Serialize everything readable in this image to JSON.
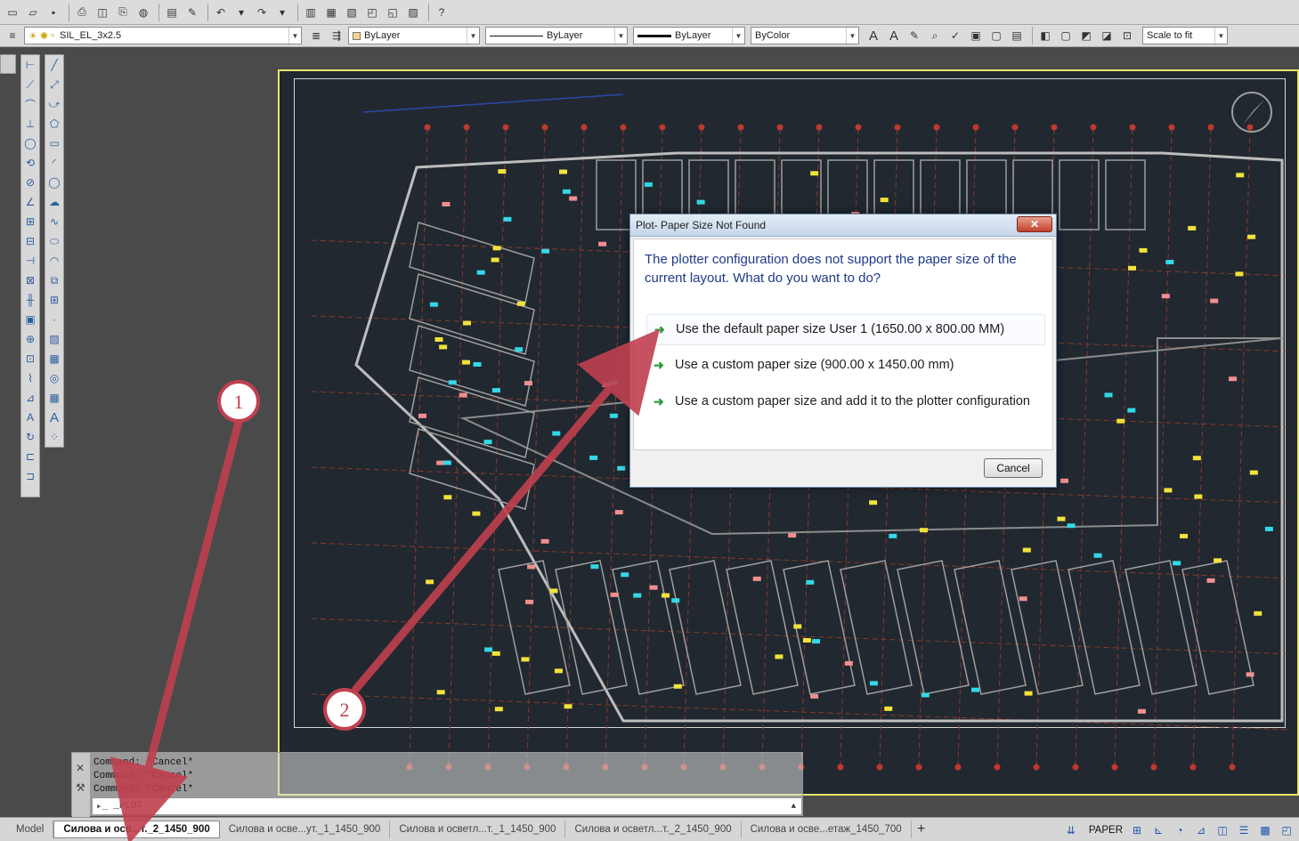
{
  "toolbar": {
    "layer_name": "SIL_EL_3x2.5",
    "color": "ByLayer",
    "linetype": "ByLayer",
    "lineweight": "ByLayer",
    "plotstyle": "ByColor",
    "scale": "Scale to fit"
  },
  "dialog": {
    "title": "Plot- Paper Size Not Found",
    "message": "The plotter configuration does not support the paper size of the current layout. What do you want to do?",
    "options": [
      "Use the default paper size User 1 (1650.00 x 800.00 MM)",
      "Use a custom paper size  (900.00 x 1450.00 mm)",
      "Use a custom paper size and add it to the plotter configuration"
    ],
    "cancel_label": "Cancel",
    "close_label": "✕"
  },
  "command": {
    "lines": [
      "Command: *Cancel*",
      "Command: *Cancel*",
      "Command: *Cancel*"
    ],
    "input": "_PLOT"
  },
  "tabs": [
    {
      "label": "Model",
      "active": false
    },
    {
      "label": "Силова и осв...т._2_1450_900",
      "active": true
    },
    {
      "label": "Силова и осве...ут._1_1450_900",
      "active": false
    },
    {
      "label": "Силова и осветл...т._1_1450_900",
      "active": false
    },
    {
      "label": "Силова и осветл...т._2_1450_900",
      "active": false
    },
    {
      "label": "Силова и осве...етаж_1450_700",
      "active": false
    }
  ],
  "status": {
    "space": "PAPER"
  },
  "annotations": [
    {
      "number": "1"
    },
    {
      "number": "2"
    }
  ],
  "colors": {
    "annotation": "#c0404f",
    "canvas": "#212830",
    "sheet_border": "#e6e66a"
  }
}
